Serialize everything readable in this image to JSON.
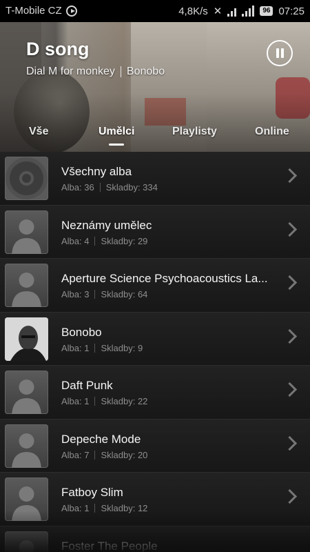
{
  "status_bar": {
    "carrier": "T-Mobile CZ",
    "net_speed": "4,8K/s",
    "battery": "96",
    "time": "07:25"
  },
  "now_playing": {
    "title": "D song",
    "album": "Dial M for monkey",
    "artist": "Bonobo"
  },
  "tabs": [
    {
      "label": "Vše"
    },
    {
      "label": "Umělci"
    },
    {
      "label": "Playlisty"
    },
    {
      "label": "Online"
    }
  ],
  "active_tab": "Umělci",
  "artists": [
    {
      "name": "Všechny alba",
      "albums": "Alba: 36",
      "tracks": "Skladby: 334",
      "thumb": "disc"
    },
    {
      "name": "Neznámy umělec",
      "albums": "Alba: 4",
      "tracks": "Skladby: 29",
      "thumb": "avatar"
    },
    {
      "name": "Aperture Science Psychoacoustics La...",
      "albums": "Alba: 3",
      "tracks": "Skladby: 64",
      "thumb": "avatar"
    },
    {
      "name": "Bonobo",
      "albums": "Alba: 1",
      "tracks": "Skladby: 9",
      "thumb": "photo"
    },
    {
      "name": "Daft Punk",
      "albums": "Alba: 1",
      "tracks": "Skladby: 22",
      "thumb": "avatar"
    },
    {
      "name": "Depeche Mode",
      "albums": "Alba: 7",
      "tracks": "Skladby: 20",
      "thumb": "avatar"
    },
    {
      "name": "Fatboy Slim",
      "albums": "Alba: 1",
      "tracks": "Skladby: 12",
      "thumb": "avatar"
    },
    {
      "name": "Foster The People",
      "albums": "",
      "tracks": "",
      "thumb": "avatar"
    }
  ]
}
